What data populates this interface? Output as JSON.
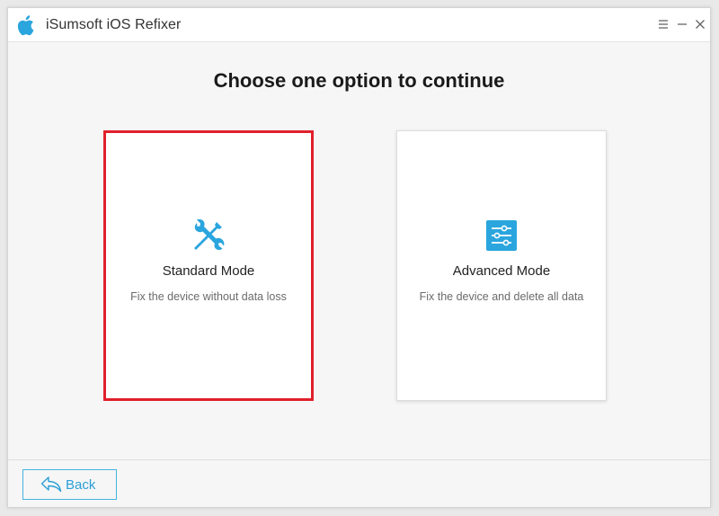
{
  "app": {
    "title": "iSumsoft iOS Refixer",
    "logo_icon": "apple-logo-icon",
    "brand_color": "#2aa5de"
  },
  "window_controls": [
    {
      "name": "menu",
      "icon": "hamburger-menu-icon"
    },
    {
      "name": "minimize",
      "icon": "minimize-icon"
    },
    {
      "name": "close",
      "icon": "close-icon"
    }
  ],
  "main": {
    "heading": "Choose one option to continue",
    "modes": [
      {
        "title": "Standard Mode",
        "description": "Fix the device without data loss",
        "icon": "wrench-screwdriver-icon",
        "selected": true
      },
      {
        "title": "Advanced Mode",
        "description": "Fix the device and delete all data",
        "icon": "sliders-settings-icon",
        "selected": false
      }
    ],
    "selection_color": "#e0202b"
  },
  "footer": {
    "back_label": "Back",
    "back_icon": "back-arrow-icon"
  }
}
